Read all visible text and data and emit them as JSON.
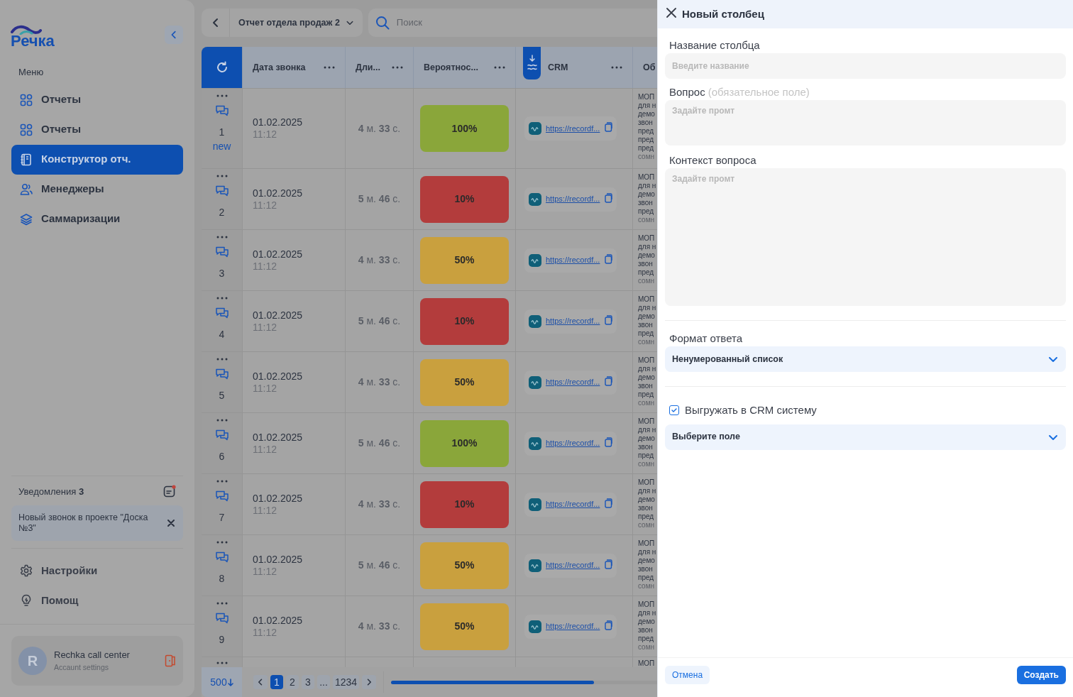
{
  "sidebar": {
    "logo": "Речка",
    "menu_label": "Меню",
    "items": [
      {
        "label": "Отчеты",
        "selected": false
      },
      {
        "label": "Отчеты",
        "selected": false
      },
      {
        "label": "Конструктор отч.",
        "selected": true
      },
      {
        "label": "Менеджеры",
        "selected": false
      },
      {
        "label": "Саммаризации",
        "selected": false
      }
    ],
    "notifications": {
      "label": "Уведомления **3**",
      "items": [
        {
          "text": "Новый звонок в проекте \"Доска №3\""
        }
      ]
    },
    "footer_items": [
      {
        "label": "Настройки"
      },
      {
        "label": "Помощ"
      }
    ],
    "account": {
      "initial": "R",
      "name": "Rechka call center",
      "subtitle": "Accaunt settings"
    }
  },
  "toolbar": {
    "report": "Отчет отдела продаж 2",
    "search_placeholder": "Поиск"
  },
  "table": {
    "columns": [
      "Дата звонка",
      "Дли...",
      "Вероятнос...",
      "CRM",
      "Об"
    ],
    "rows": [
      {
        "number": "1",
        "badge": "new",
        "date": "01.02.2025",
        "time": "11:12",
        "duration": "**4** м. **33** с.",
        "probability": "100%",
        "color": "#8aa63a",
        "crm": "https://recordf...",
        "column_5": [
          "МОП",
          "для н",
          "демо",
          "звон",
          "пред",
          "пред",
          "пред"
        ],
        "column_5_more": "сомн"
      },
      {
        "number": "2",
        "date": "01.02.2025",
        "time": "11:12",
        "duration": "**5** м. **46** с.",
        "probability": "10%",
        "color": "#b33c3c",
        "crm": "https://recordf...",
        "column_5": [
          "МОП",
          "для н",
          "демо",
          "звон",
          "пред"
        ],
        "column_5_more": "сомн"
      },
      {
        "number": "3",
        "date": "01.02.2025",
        "time": "11:12",
        "duration": "**4** м. **33** с.",
        "probability": "50%",
        "color": "#c9a03e",
        "crm": "https://recordf...",
        "column_5": [
          "МОП",
          "для н",
          "демо",
          "звон",
          "пред"
        ],
        "column_5_more": "сомн"
      },
      {
        "number": "4",
        "date": "01.02.2025",
        "time": "11:12",
        "duration": "**5** м. **46** с.",
        "probability": "10%",
        "color": "#b33c3c",
        "crm": "https://recordf...",
        "column_5": [
          "МОП",
          "для н",
          "демо",
          "звон",
          "пред"
        ],
        "column_5_more": "сомн"
      },
      {
        "number": "5",
        "date": "01.02.2025",
        "time": "11:12",
        "duration": "**4** м. **33** с.",
        "probability": "50%",
        "color": "#c9a03e",
        "crm": "https://recordf...",
        "column_5": [
          "МОП",
          "для н",
          "демо",
          "звон",
          "пред"
        ],
        "column_5_more": "сомн"
      },
      {
        "number": "6",
        "date": "01.02.2025",
        "time": "11:12",
        "duration": "**5** м. **46** с.",
        "probability": "100%",
        "color": "#8aa63a",
        "crm": "https://recordf...",
        "column_5": [
          "МОП",
          "для н",
          "демо",
          "звон",
          "пред"
        ],
        "column_5_more": "сомн"
      },
      {
        "number": "7",
        "date": "01.02.2025",
        "time": "11:12",
        "duration": "**4** м. **33** с.",
        "probability": "10%",
        "color": "#b33c3c",
        "crm": "https://recordf...",
        "column_5": [
          "МОП",
          "для н",
          "демо",
          "звон",
          "пред"
        ],
        "column_5_more": "сомн"
      },
      {
        "number": "8",
        "date": "01.02.2025",
        "time": "11:12",
        "duration": "**5** м. **46** с.",
        "probability": "50%",
        "color": "#c9a03e",
        "crm": "https://recordf...",
        "column_5": [
          "МОП",
          "для н",
          "демо",
          "звон",
          "пред"
        ],
        "column_5_more": "сомн"
      },
      {
        "number": "9",
        "date": "01.02.2025",
        "time": "11:12",
        "duration": "**4** м. **33** с.",
        "probability": "50%",
        "color": "#c9a03e",
        "crm": "https://recordf...",
        "column_5": [
          "МОП",
          "для н",
          "демо",
          "звон",
          "пред"
        ],
        "column_5_more": "сомн"
      }
    ],
    "partial_row": {
      "column_5": "МОП"
    }
  },
  "pagination": {
    "page_size": "500",
    "pages": [
      {
        "label": "1",
        "selected": true
      },
      {
        "label": "2",
        "selected": false
      },
      {
        "label": "3",
        "selected": false
      },
      {
        "label": "...",
        "selected": false
      },
      {
        "label": "1234",
        "selected": false
      }
    ]
  },
  "panel": {
    "title": "Новый столбец",
    "name_field": {
      "label": "Название столбца",
      "placeholder": "Введите название"
    },
    "question_field": {
      "label": "Вопрос",
      "hint": "(обязательное поле)",
      "placeholder": "Задайте промт"
    },
    "context_field": {
      "label": "Контекст вопроса",
      "placeholder": "Задайте промт"
    },
    "format_field": {
      "label": "Формат ответа",
      "value": "Ненумерованный список"
    },
    "crm_export": {
      "label": "Выгружать в CRM систему",
      "checked": true
    },
    "crm_field": {
      "value": "Выберите поле"
    },
    "buttons": {
      "cancel": "Отмена",
      "create": "Создать"
    }
  }
}
